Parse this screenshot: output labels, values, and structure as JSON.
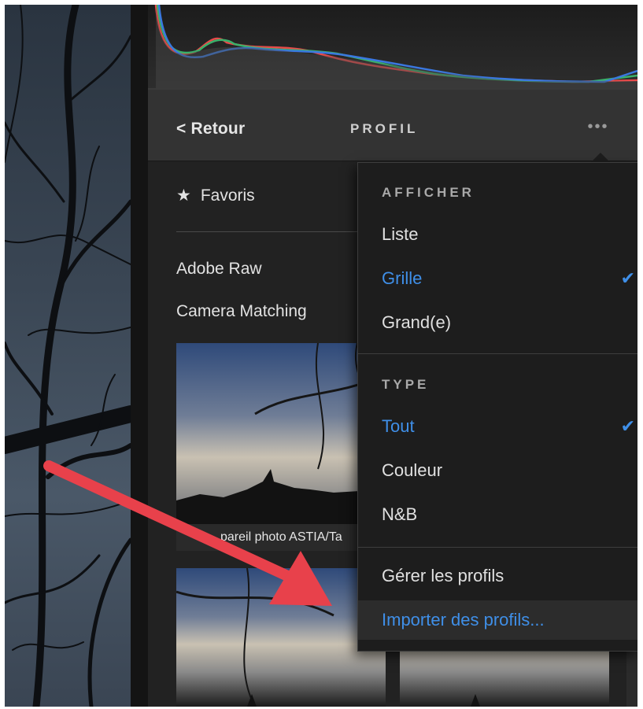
{
  "header": {
    "back_icon": "chevron-left-icon",
    "back_label": "Retour",
    "title": "PROFIL",
    "more_icon": "more-horizontal-icon",
    "more_label": "•••"
  },
  "profiles": {
    "favorites_icon": "star-icon",
    "favorites_label": "Favoris",
    "groups": [
      "Adobe Raw",
      "Camera Matching"
    ],
    "thumbnails": [
      {
        "caption": "…pareil photo ASTIA/Ta"
      },
      {
        "caption": ""
      },
      {
        "caption": ""
      }
    ]
  },
  "menu": {
    "afficher_title": "AFFICHER",
    "afficher_items": [
      {
        "label": "Liste",
        "selected": false
      },
      {
        "label": "Grille",
        "selected": true
      },
      {
        "label": "Grand(e)",
        "selected": false
      }
    ],
    "type_title": "TYPE",
    "type_items": [
      {
        "label": "Tout",
        "selected": true
      },
      {
        "label": "Couleur",
        "selected": false
      },
      {
        "label": "N&B",
        "selected": false
      }
    ],
    "manage_label": "Gérer les profils",
    "import_label": "Importer des profils..."
  },
  "colors": {
    "accent": "#3f8fe8",
    "annotation_arrow": "#e8414b",
    "panel_bg": "#222222",
    "menu_bg": "#1d1d1d"
  }
}
